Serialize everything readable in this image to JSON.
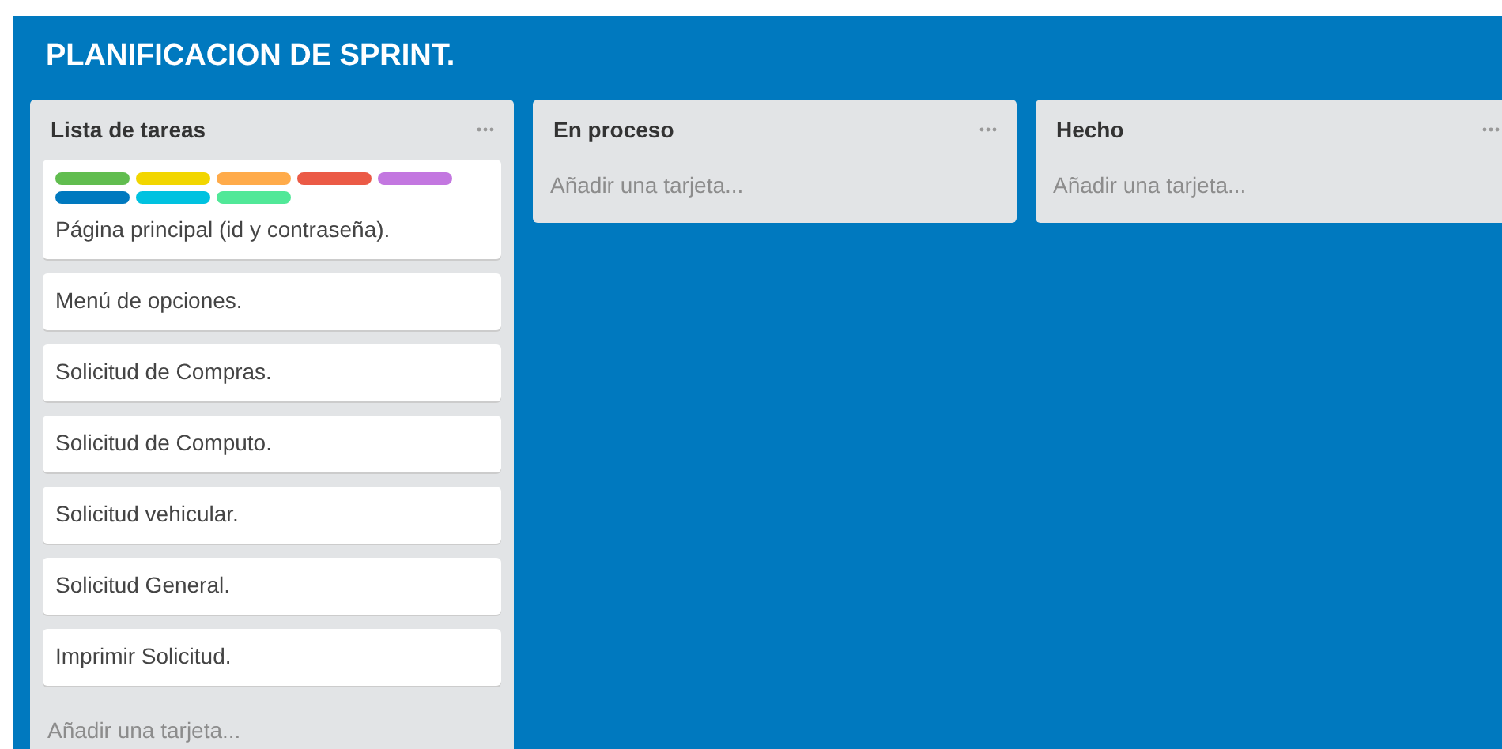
{
  "board": {
    "title": "PLANIFICACION DE SPRINT."
  },
  "lists": [
    {
      "title": "Lista de tareas",
      "cards": [
        {
          "labels": [
            {
              "color": "#61bd4f"
            },
            {
              "color": "#f2d600"
            },
            {
              "color": "#ffab4a"
            },
            {
              "color": "#eb5a46"
            },
            {
              "color": "#c377e0"
            },
            {
              "color": "#0079bf"
            },
            {
              "color": "#00c2e0"
            },
            {
              "color": "#51e898"
            }
          ],
          "text": "Página principal (id y contraseña)."
        },
        {
          "text": "Menú de opciones."
        },
        {
          "text": "Solicitud de Compras."
        },
        {
          "text": "Solicitud de Computo."
        },
        {
          "text": "Solicitud vehicular."
        },
        {
          "text": "Solicitud General."
        },
        {
          "text": "Imprimir Solicitud."
        }
      ],
      "add_card": "Añadir una tarjeta..."
    },
    {
      "title": "En proceso",
      "add_card": "Añadir una tarjeta..."
    },
    {
      "title": "Hecho",
      "add_card": "Añadir una tarjeta..."
    }
  ]
}
